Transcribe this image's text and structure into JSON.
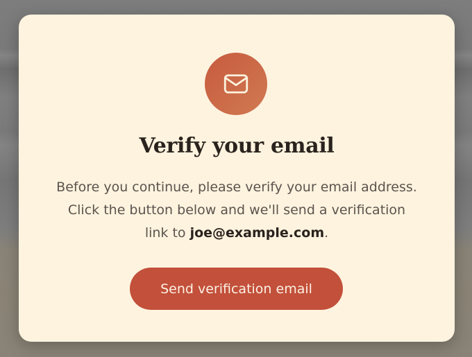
{
  "modal": {
    "icon": "envelope-icon",
    "title": "Verify your email",
    "body_prefix": "Before you continue, please verify your email address. Click the button below and we'll send a verification link to ",
    "email": "joe@example.com",
    "body_suffix": ".",
    "button_label": "Send verification email"
  },
  "colors": {
    "accent": "#c2503a",
    "modal_background": "#fdf3df",
    "title_text": "#2a221d",
    "body_text": "#5c534d"
  }
}
